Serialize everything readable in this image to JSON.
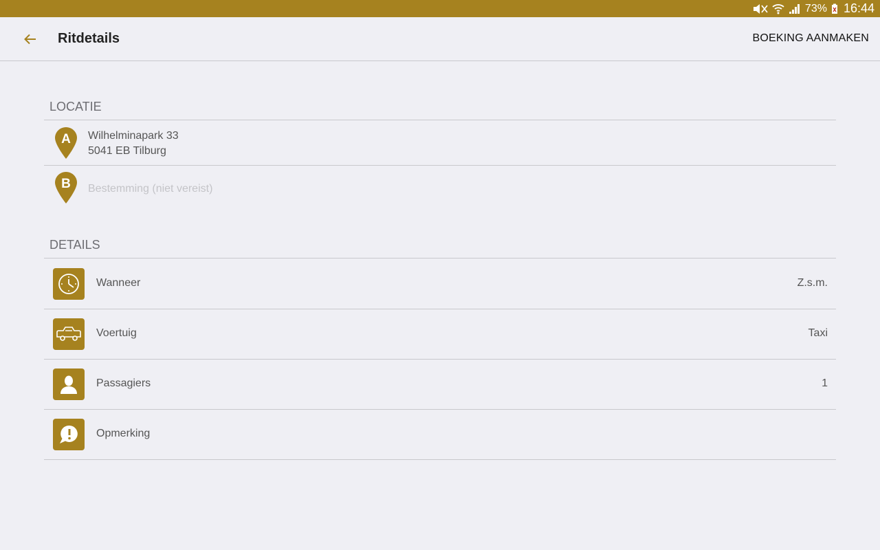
{
  "status_bar": {
    "battery": "73%",
    "time": "16:44",
    "icons": [
      "mute-icon",
      "wifi-icon",
      "signal-icon",
      "battery-icon"
    ]
  },
  "app_bar": {
    "title": "Ritdetails",
    "action": "BOEKING AANMAKEN"
  },
  "location": {
    "header": "LOCATIE",
    "pickup": {
      "marker": "A",
      "line1": "Wilhelminapark 33",
      "line2": "5041 EB Tilburg"
    },
    "destination": {
      "marker": "B",
      "placeholder": "Bestemming (niet vereist)"
    }
  },
  "details": {
    "header": "DETAILS",
    "rows": [
      {
        "icon": "clock-icon",
        "label": "Wanneer",
        "value": "Z.s.m."
      },
      {
        "icon": "car-icon",
        "label": "Voertuig",
        "value": "Taxi"
      },
      {
        "icon": "person-icon",
        "label": "Passagiers",
        "value": "1"
      },
      {
        "icon": "comment-icon",
        "label": "Opmerking",
        "value": ""
      }
    ]
  },
  "colors": {
    "accent": "#a6821f",
    "background": "#efeff4",
    "divider": "#c8c8cc"
  }
}
